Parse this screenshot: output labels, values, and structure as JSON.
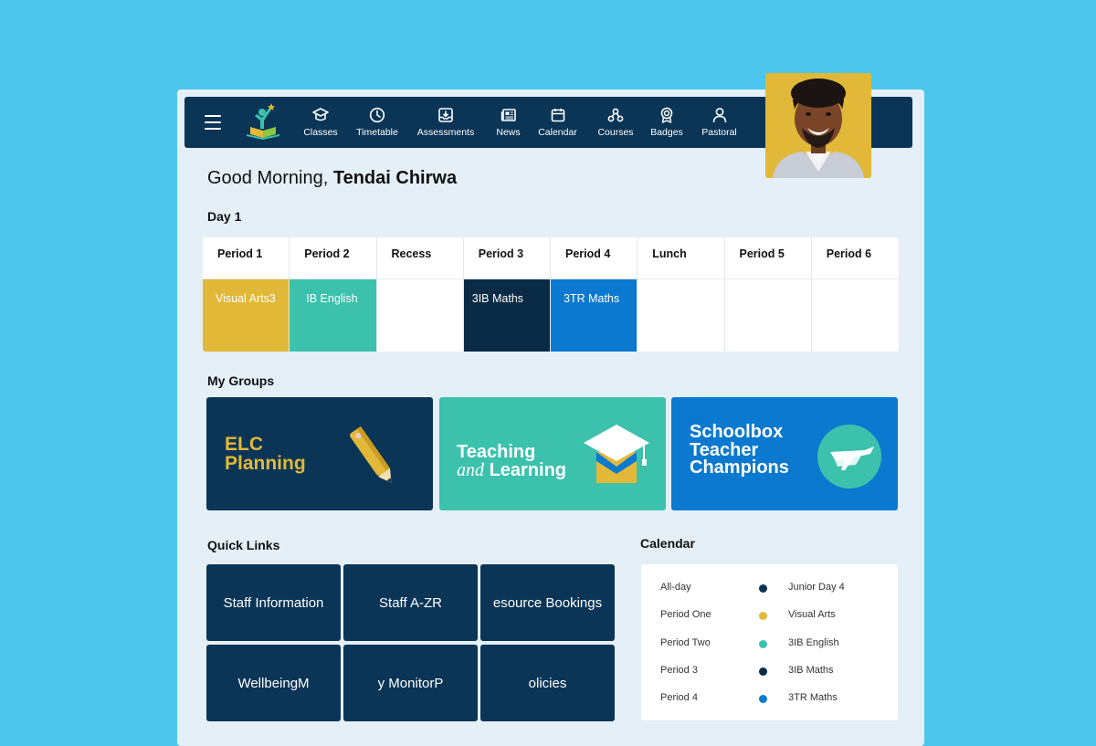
{
  "nav": {
    "items": [
      {
        "label": "Classes",
        "icon": "graduation-cap-icon"
      },
      {
        "label": "Timetable",
        "icon": "clock-icon"
      },
      {
        "label": "Assessments",
        "icon": "inbox-download-icon"
      },
      {
        "label": "News",
        "icon": "newspaper-icon"
      },
      {
        "label": "Calendar",
        "icon": "calendar-icon"
      },
      {
        "label": "Courses",
        "icon": "molecule-icon"
      },
      {
        "label": "Badges",
        "icon": "award-badge-icon"
      },
      {
        "label": "Pastoral",
        "icon": "user-icon"
      }
    ]
  },
  "greeting": {
    "prefix": "Good Morning,",
    "name": "Tendai Chirwa"
  },
  "timetable": {
    "title": "Day 1",
    "periods": [
      {
        "head": "Period 1",
        "cell": "Visual Arts3",
        "color": "#e2b838"
      },
      {
        "head": "Period 2",
        "cell": "IB English",
        "color": "#3cc1ad"
      },
      {
        "head": "Recess",
        "cell": "",
        "color": "#ffffff"
      },
      {
        "head": "Period 3",
        "cell": "3IB Maths",
        "color": "#0a2b45"
      },
      {
        "head": "Period 4",
        "cell": "3TR Maths",
        "color": "#0b79cf"
      },
      {
        "head": "Lunch",
        "cell": "",
        "color": "#ffffff"
      },
      {
        "head": "Period 5",
        "cell": "",
        "color": "#ffffff"
      },
      {
        "head": "Period 6",
        "cell": "",
        "color": "#ffffff"
      }
    ]
  },
  "groups": {
    "title": "My Groups",
    "items": [
      {
        "line1": "ELC",
        "line2": "Planning",
        "bg": "#0b3556",
        "fg": "#e2b838"
      },
      {
        "line1": "Teaching",
        "line2a": "and",
        "line2b": "Learning",
        "bg": "#3cc1ad",
        "fg": "#ffffff"
      },
      {
        "line1": "Schoolbox",
        "line2": "Teacher",
        "line3": "Champions",
        "bg": "#0b79cf",
        "fg": "#ffffff"
      }
    ]
  },
  "quick_links": {
    "title": "Quick Links",
    "items": [
      "Staff Information",
      "Staff A-ZR",
      "esource Bookings",
      "WellbeingM",
      "y MonitorP",
      "olicies"
    ]
  },
  "calendar": {
    "title": "Calendar",
    "rows": [
      {
        "time": "All-day",
        "event": "Junior Day 4",
        "color": "#0b3556"
      },
      {
        "time": "Period One",
        "event": "Visual Arts",
        "color": "#e2b838"
      },
      {
        "time": "Period Two",
        "event": "3IB English",
        "color": "#3cc1ad"
      },
      {
        "time": "Period 3",
        "event": "3IB Maths",
        "color": "#0a2b45"
      },
      {
        "time": "Period 4",
        "event": "3TR Maths",
        "color": "#0b79cf"
      }
    ]
  },
  "colors": {
    "background": "#4cc6ec",
    "navy": "#0b3556",
    "teal": "#3cc1ad",
    "yellow": "#e2b838",
    "blue": "#0b79cf"
  }
}
